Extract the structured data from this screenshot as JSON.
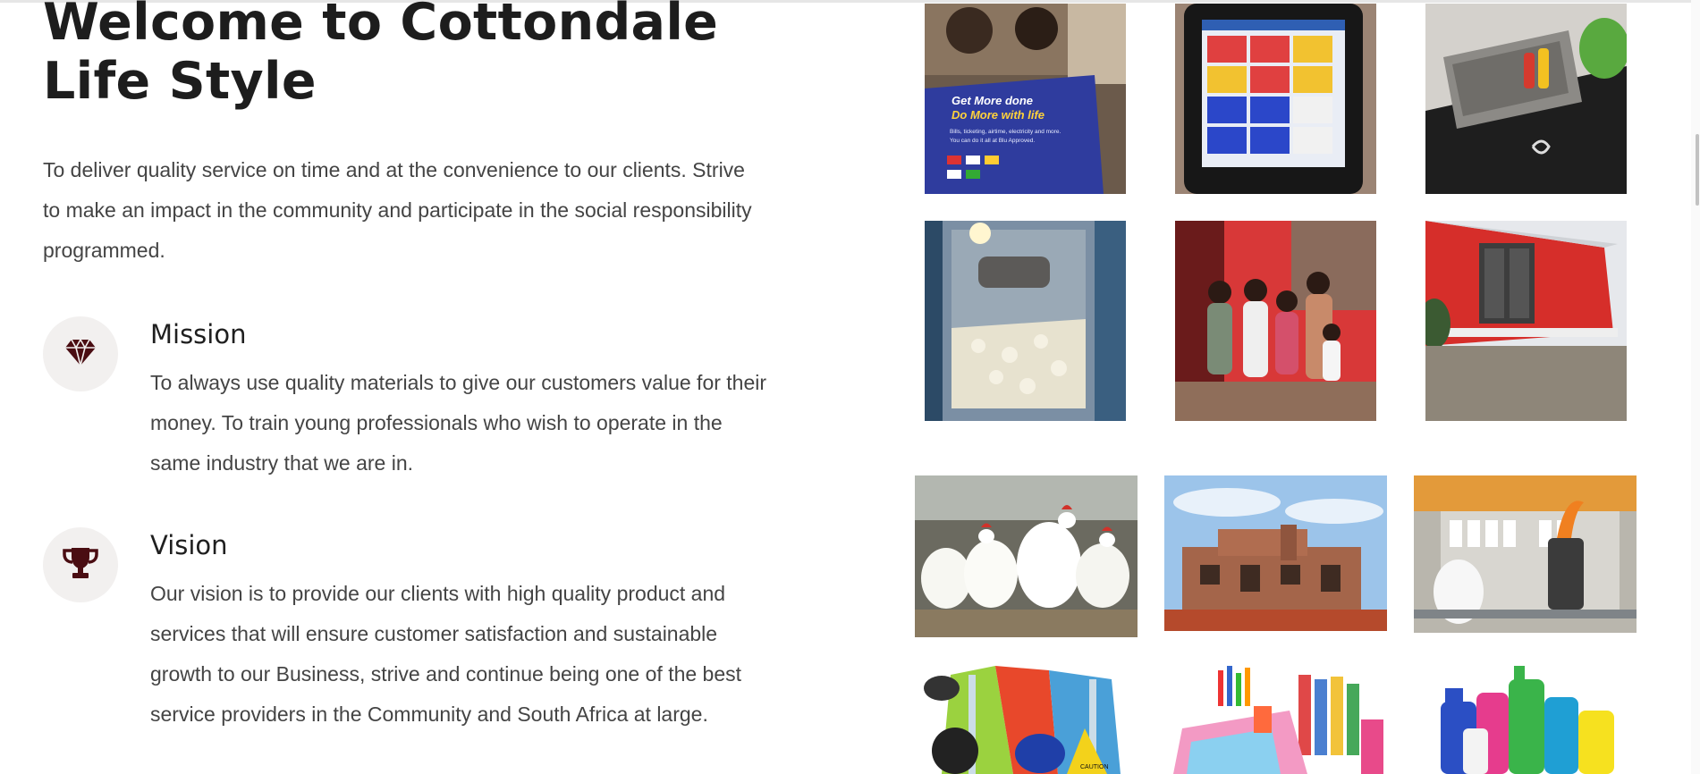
{
  "hero": {
    "title": "Welcome to Cottondale Life Style",
    "intro": "To deliver quality service on time and at the convenience to our clients. Strive to make an impact in the community and participate in the social responsibility programmed."
  },
  "features": [
    {
      "icon": "diamond-icon",
      "title": "Mission",
      "text": "To always use quality materials to give our customers value for their money. To train young professionals who wish to operate in the same industry that we are in."
    },
    {
      "icon": "trophy-icon",
      "title": "Vision",
      "text": "Our vision is to provide our clients with high quality product and services that will ensure customer satisfaction and sustainable growth to our Business, strive and continue being one of the best service providers in the Community and South Africa at large."
    }
  ],
  "gallery": {
    "poster_lines": [
      "Get More done",
      "Do More with life",
      "Bills, ticketing, airtime, electricity and more.",
      "You can do it all at Blu Approved."
    ],
    "sign_text": "CAUTION",
    "photos": [
      "promo-poster-photo",
      "tablet-app-photo",
      "kitchen-counter-photo",
      "popcorn-machine-photo",
      "family-group-photo",
      "red-house-photo",
      "chickens-photo",
      "brick-house-photo",
      "electrician-photo",
      "safety-gear-photo",
      "stationery-photo",
      "cleaning-products-photo"
    ]
  },
  "colors": {
    "icon": "#4a0d12",
    "badge_bg": "#f2f0ef",
    "text": "#444444",
    "heading": "#1d1d1d"
  }
}
